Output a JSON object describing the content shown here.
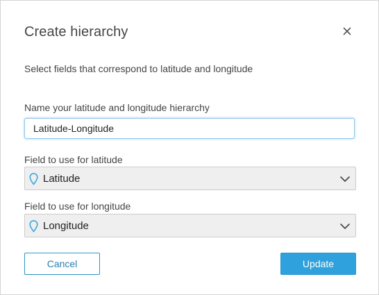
{
  "dialog": {
    "title": "Create hierarchy",
    "subtitle": "Select fields that correspond to latitude and longitude",
    "close_icon": "close-icon"
  },
  "hierarchy_name": {
    "label": "Name your latitude and longitude hierarchy",
    "value": "Latitude-Longitude"
  },
  "latitude_field": {
    "label": "Field to use for latitude",
    "selected": "Latitude",
    "icon": "map-pin-icon"
  },
  "longitude_field": {
    "label": "Field to use for longitude",
    "selected": "Longitude",
    "icon": "map-pin-icon"
  },
  "buttons": {
    "cancel_label": "Cancel",
    "update_label": "Update"
  },
  "colors": {
    "accent": "#2fa1dc",
    "pin": "#3aa8dd",
    "focus_border": "#8fc7ec"
  }
}
